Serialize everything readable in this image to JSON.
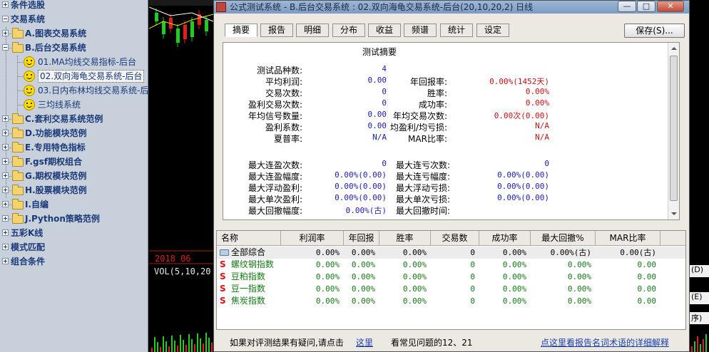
{
  "tree": {
    "items": [
      {
        "label": "条件选股"
      },
      {
        "label": "交易系统"
      },
      {
        "label": "A.图表交易系统"
      },
      {
        "label": "B.后台交易系统"
      },
      {
        "label": "01.MA均线交易指标-后台"
      },
      {
        "label": "02.双向海龟交易系统-后台"
      },
      {
        "label": "03.日内布林均线交易系统-后"
      },
      {
        "label": "三均线系统"
      },
      {
        "label": "C.套利交易系统范例"
      },
      {
        "label": "D.功能模块范例"
      },
      {
        "label": "E.专用特色指标"
      },
      {
        "label": "F.gsf期权组合"
      },
      {
        "label": "G.期权模块范例"
      },
      {
        "label": "H.股票模块范例"
      },
      {
        "label": "I.自编"
      },
      {
        "label": "J.Python策略范例"
      },
      {
        "label": "五彩K线"
      },
      {
        "label": "模式匹配"
      },
      {
        "label": "组合条件"
      }
    ]
  },
  "chart": {
    "date_label": "2018 06",
    "vol_label": "VOL(5,10,20",
    "right_strip": [
      "(D)",
      "(E)",
      "序)"
    ]
  },
  "dialog": {
    "title": "公式测试系统 - B.后台交易系统 : 02.双向海龟交易系统-后台(20,10,20,2) 日线",
    "controls": {
      "minimize": "—",
      "maximize": "□",
      "close": "✕"
    },
    "tabs": [
      "摘要",
      "报告",
      "明细",
      "分布",
      "收益",
      "频谱",
      "统计",
      "设定"
    ],
    "save_button": "保存(S)...",
    "summary": {
      "title": "测试摘要",
      "rows": [
        {
          "l1": "测试品种数:",
          "v1": "4",
          "l2": "",
          "v2": ""
        },
        {
          "l1": "平均利润:",
          "v1": "0.00",
          "l2": "年回报率:",
          "v2": "0.00%(1452天)"
        },
        {
          "l1": "交易次数:",
          "v1": "0",
          "l2": "胜率:",
          "v2": "0.00%"
        },
        {
          "l1": "盈利交易次数:",
          "v1": "0",
          "l2": "成功率:",
          "v2": "0.00%"
        },
        {
          "l1": "年均信号数量:",
          "v1": "0.00",
          "l2": "年均交易次数:",
          "v2": "0.00次(0.00)"
        },
        {
          "l1": "盈利系数:",
          "v1": "0.00",
          "l2": "均盈利/均亏损:",
          "v2": "N/A"
        },
        {
          "l1": "夏普率:",
          "v1": "N/A",
          "l2": "MAR比率:",
          "v2": "N/A"
        }
      ],
      "rows2": [
        {
          "l1": "最大连盈次数:",
          "v1": "0",
          "l2": "最大连亏次数:",
          "v2": "0"
        },
        {
          "l1": "最大连盈幅度:",
          "v1": "0.00%(0.00)",
          "l2": "最大连亏幅度:",
          "v2": "0.00%(0.00)"
        },
        {
          "l1": "最大浮动盈利:",
          "v1": "0.00%(0.00)",
          "l2": "最大浮动亏损:",
          "v2": "0.00%(0.00)"
        },
        {
          "l1": "最大单次盈利:",
          "v1": "0.00%(0.00)",
          "l2": "最大单次亏损:",
          "v2": "0.00%(0.00)"
        },
        {
          "l1": "最大回撤幅度:",
          "v1": "0.00%(古)",
          "l2": "最大回撤时间:",
          "v2": ""
        }
      ]
    },
    "results": {
      "headers": [
        "名称",
        "利润率",
        "年回报",
        "胜率",
        "交易数",
        "成功率",
        "最大回撤%",
        "MAR比率"
      ],
      "rows": [
        {
          "name": "全部综合",
          "cells": [
            "0.00%",
            "0.00%",
            "0.00%",
            "0",
            "0.00%",
            "0.00%(古)",
            "0.00(古)"
          ]
        },
        {
          "name": "螺纹钢指数",
          "cells": [
            "0.00%",
            "0.00%",
            "0.00%",
            "0",
            "0.00%",
            "0.00%",
            "0.00"
          ]
        },
        {
          "name": "豆粕指数",
          "cells": [
            "0.00%",
            "0.00%",
            "0.00%",
            "0",
            "0.00%",
            "0.00%",
            "0.00"
          ]
        },
        {
          "name": "豆一指数",
          "cells": [
            "0.00%",
            "0.00%",
            "0.00%",
            "0",
            "0.00%",
            "0.00%",
            "0.00"
          ]
        },
        {
          "name": "焦炭指数",
          "cells": [
            "0.00%",
            "0.00%",
            "0.00%",
            "0",
            "0.00%",
            "0.00%",
            "0.00"
          ]
        }
      ],
      "s_glyph": "S"
    },
    "bottom": {
      "prompt": "如果对评测结果有疑问,请点击",
      "link1": "这里",
      "faq": "看常见问题的12、21",
      "link2": "点这里看报告名词术语的详细解释"
    }
  }
}
